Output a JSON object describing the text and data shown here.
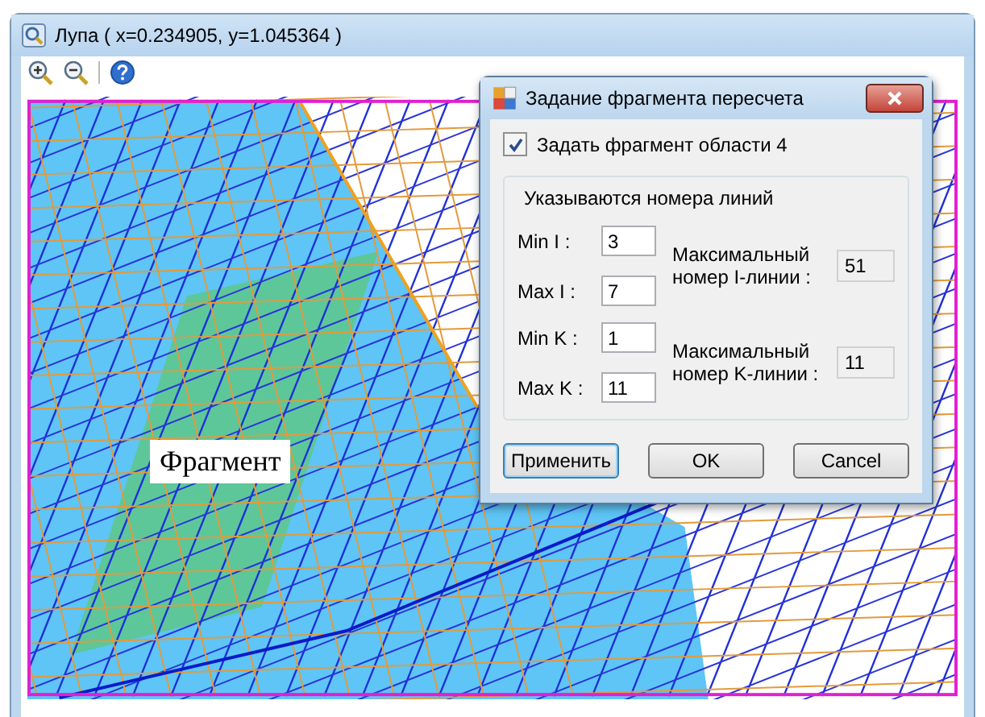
{
  "window": {
    "title": "Лупа ( x=0.234905, y=1.045364 )"
  },
  "canvas": {
    "label": "Фрагмент"
  },
  "dialog": {
    "title": "Задание фрагмента пересчета",
    "checkbox": {
      "label": "Задать фрагмент области 4",
      "checked": true
    },
    "group": {
      "title": "Указываются номера линий",
      "blocks": [
        {
          "fields": [
            {
              "label": "Min I :",
              "value": "3"
            },
            {
              "label": "Max I :",
              "value": "7"
            }
          ],
          "readout": {
            "label": "Максимальный номер I-линии :",
            "value": "51"
          }
        },
        {
          "fields": [
            {
              "label": "Min K :",
              "value": "1"
            },
            {
              "label": "Max K :",
              "value": "11"
            }
          ],
          "readout": {
            "label": "Максимальный номер K-линии :",
            "value": "11"
          }
        }
      ]
    },
    "buttons": [
      {
        "label": "Применить",
        "focused": true
      },
      {
        "label": "OK",
        "focused": false
      },
      {
        "label": "Cancel",
        "focused": false
      }
    ]
  }
}
